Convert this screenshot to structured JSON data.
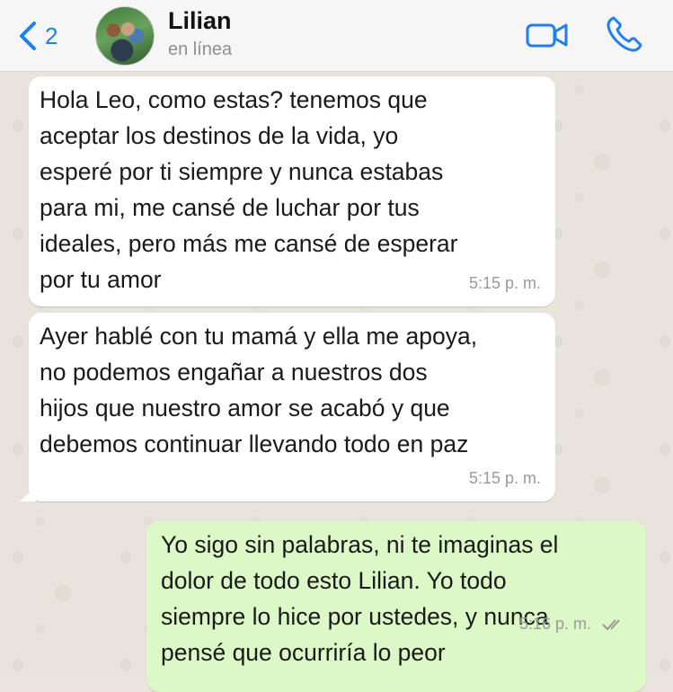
{
  "header": {
    "back_count": "2",
    "contact_name": "Lilian",
    "contact_status": "en línea"
  },
  "messages": [
    {
      "direction": "incoming",
      "text": "Hola Leo, como estas? tenemos que\naceptar los destinos de la vida, yo\nesperé por ti siempre y nunca estabas\npara mi, me cansé de luchar por tus\nideales, pero más me cansé de esperar\npor tu amor",
      "time": "5:15 p. m."
    },
    {
      "direction": "incoming",
      "text": "Ayer hablé con tu mamá y ella me apoya,\nno podemos engañar a nuestros dos\nhijos que nuestro amor se acabó y que\ndebemos continuar llevando todo en paz",
      "time": "5:15 p. m."
    },
    {
      "direction": "outgoing",
      "text": "Yo sigo sin palabras, ni te imaginas el\ndolor de todo esto Lilian. Yo todo\nsiempre lo hice por ustedes, y nunca\npensé que ocurriría lo peor",
      "time": "5:16 p. m.",
      "status_icon": "double-check-icon"
    }
  ],
  "colors": {
    "accent": "#1f7ff0",
    "incoming_bubble": "#ffffff",
    "outgoing_bubble": "#dcf8c6",
    "background": "#e9e4db"
  }
}
